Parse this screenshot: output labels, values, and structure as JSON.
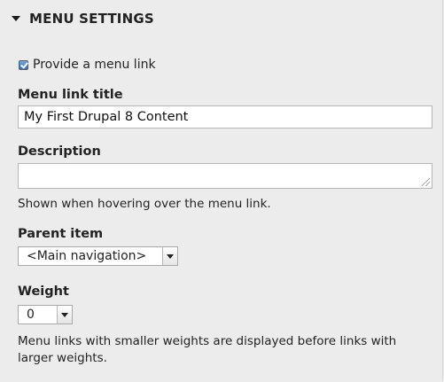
{
  "section": {
    "title": "MENU SETTINGS",
    "expanded": true
  },
  "provide_link": {
    "label": "Provide a menu link",
    "checked": true
  },
  "menu_link_title": {
    "label": "Menu link title",
    "value": "My First Drupal 8 Content"
  },
  "description": {
    "label": "Description",
    "value": "",
    "help": "Shown when hovering over the menu link."
  },
  "parent_item": {
    "label": "Parent item",
    "selected": "<Main navigation>"
  },
  "weight": {
    "label": "Weight",
    "selected": "0",
    "help": "Menu links with smaller weights are displayed before links with larger weights."
  },
  "colors": {
    "background": "#ececec",
    "checkbox_accent": "#2a6fd6"
  }
}
